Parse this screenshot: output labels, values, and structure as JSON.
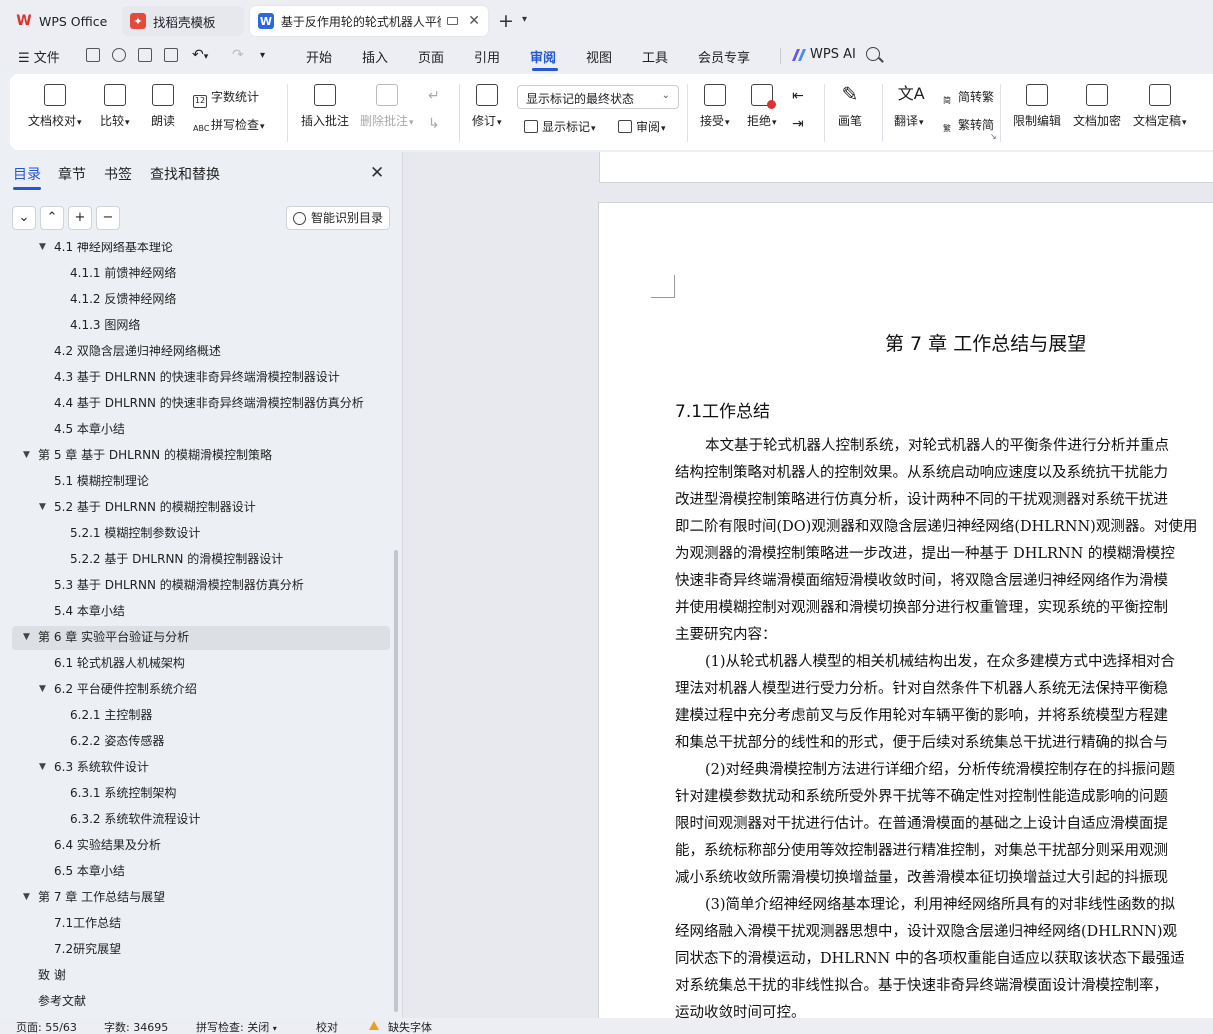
{
  "tabs": [
    {
      "label": "WPS Office"
    },
    {
      "label": "找稻壳模板"
    },
    {
      "label": "基于反作用轮的轮式机器人平衡"
    }
  ],
  "menubar": {
    "file": "文件",
    "items": [
      "开始",
      "插入",
      "页面",
      "引用",
      "审阅",
      "视图",
      "工具",
      "会员专享"
    ],
    "ai": "WPS AI",
    "active": "审阅"
  },
  "ribbon": {
    "doc_check": "文档校对",
    "compare": "比较",
    "read_aloud": "朗读",
    "word_count": "字数统计",
    "spell_check": "拼写检查",
    "insert_comment": "插入批注",
    "delete_comment": "删除批注",
    "track_changes": "修订",
    "markup_mode": "显示标记的最终状态",
    "show_markup": "显示标记",
    "review_pane": "审阅",
    "accept": "接受",
    "reject": "拒绝",
    "pen": "画笔",
    "translate": "翻译",
    "to_traditional": "简转繁",
    "to_simplified": "繁转简",
    "restrict_edit": "限制编辑",
    "encrypt": "文档加密",
    "finalize": "文档定稿"
  },
  "navpane": {
    "tabs": [
      "目录",
      "章节",
      "书签",
      "查找和替换"
    ],
    "smart_toc": "智能识别目录",
    "toc": [
      {
        "text": "4.1 神经网络基本理论",
        "level": 2,
        "expanded": true
      },
      {
        "text": "4.1.1  前馈神经网络",
        "level": 3
      },
      {
        "text": "4.1.2  反馈神经网络",
        "level": 3
      },
      {
        "text": "4.1.3  图网络",
        "level": 3
      },
      {
        "text": "4.2  双隐含层递归神经网络概述",
        "level": 2
      },
      {
        "text": "4.3  基于 DHLRNN 的快速非奇异终端滑模控制器设计",
        "level": 2
      },
      {
        "text": "4.4  基于 DHLRNN 的快速非奇异终端滑模控制器仿真分析",
        "level": 2
      },
      {
        "text": "4.5  本章小结",
        "level": 2
      },
      {
        "text": "第 5 章  基于 DHLRNN 的模糊滑模控制策略",
        "level": 1,
        "expanded": true
      },
      {
        "text": "5.1  模糊控制理论",
        "level": 2
      },
      {
        "text": "5.2  基于 DHLRNN 的模糊控制器设计",
        "level": 2,
        "expanded": true
      },
      {
        "text": "5.2.1  模糊控制参数设计",
        "level": 3
      },
      {
        "text": "5.2.2  基于 DHLRNN 的滑模控制器设计",
        "level": 3
      },
      {
        "text": "5.3  基于 DHLRNN 的模糊滑模控制器仿真分析",
        "level": 2
      },
      {
        "text": "5.4  本章小结",
        "level": 2
      },
      {
        "text": "第 6 章  实验平台验证与分析",
        "level": 1,
        "expanded": true,
        "selected": true
      },
      {
        "text": "6.1  轮式机器人机械架构",
        "level": 2
      },
      {
        "text": "6.2  平台硬件控制系统介绍",
        "level": 2,
        "expanded": true
      },
      {
        "text": "6.2.1  主控制器",
        "level": 3
      },
      {
        "text": "6.2.2  姿态传感器",
        "level": 3
      },
      {
        "text": "6.3  系统软件设计",
        "level": 2,
        "expanded": true
      },
      {
        "text": "6.3.1  系统控制架构",
        "level": 3
      },
      {
        "text": "6.3.2  系统软件流程设计",
        "level": 3
      },
      {
        "text": "6.4  实验结果及分析",
        "level": 2
      },
      {
        "text": "6.5  本章小结",
        "level": 2
      },
      {
        "text": "第 7 章  工作总结与展望",
        "level": 1,
        "expanded": true
      },
      {
        "text": "7.1工作总结",
        "level": 2
      },
      {
        "text": "7.2研究展望",
        "level": 2
      },
      {
        "text": "致  谢",
        "level": 1
      },
      {
        "text": "参考文献",
        "level": 1
      }
    ]
  },
  "document": {
    "chapter_title": "第 7 章  工作总结与展望",
    "section_title": "7.1工作总结",
    "lines": [
      {
        "text": "本文基于轮式机器人控制系统，对轮式机器人的平衡条件进行分析并重点",
        "indent": true
      },
      {
        "text": "结构控制策略对机器人的控制效果。从系统启动响应速度以及系统抗干扰能力",
        "indent": false
      },
      {
        "text": "改进型滑模控制策略进行仿真分析，设计两种不同的干扰观测器对系统干扰进",
        "indent": false
      },
      {
        "text": "即二阶有限时间(DO)观测器和双隐含层递归神经网络(DHLRNN)观测器。对使用",
        "indent": false
      },
      {
        "text": "为观测器的滑模控制策略进一步改进，提出一种基于 DHLRNN 的模糊滑模控",
        "indent": false
      },
      {
        "text": "快速非奇异终端滑模面缩短滑模收敛时间，将双隐含层递归神经网络作为滑模",
        "indent": false
      },
      {
        "text": "并使用模糊控制对观测器和滑模切换部分进行权重管理，实现系统的平衡控制",
        "indent": false
      },
      {
        "text": "主要研究内容：",
        "indent": false
      },
      {
        "text": "(1)从轮式机器人模型的相关机械结构出发，在众多建模方式中选择相对合",
        "indent": true
      },
      {
        "text": "理法对机器人模型进行受力分析。针对自然条件下机器人系统无法保持平衡稳",
        "indent": false
      },
      {
        "text": "建模过程中充分考虑前叉与反作用轮对车辆平衡的影响，并将系统模型方程建",
        "indent": false
      },
      {
        "text": "和集总干扰部分的线性和的形式，便于后续对系统集总干扰进行精确的拟合与",
        "indent": false
      },
      {
        "text": "(2)对经典滑模控制方法进行详细介绍，分析传统滑模控制存在的抖振问题",
        "indent": true
      },
      {
        "text": "针对建模参数扰动和系统所受外界干扰等不确定性对控制性能造成影响的问题",
        "indent": false
      },
      {
        "text": "限时间观测器对干扰进行估计。在普通滑模面的基础之上设计自适应滑模面提",
        "indent": false
      },
      {
        "text": "能，系统标称部分使用等效控制器进行精准控制，对集总干扰部分则采用观测",
        "indent": false
      },
      {
        "text": "减小系统收敛所需滑模切换增益量，改善滑模本征切换增益过大引起的抖振现",
        "indent": false
      },
      {
        "text": "(3)简单介绍神经网络基本理论，利用神经网络所具有的对非线性函数的拟",
        "indent": true
      },
      {
        "text": "经网络融入滑模干扰观测器思想中，设计双隐含层递归神经网络(DHLRNN)观",
        "indent": false
      },
      {
        "text": "同状态下的滑模运动，DHLRNN 中的各项权重能自适应以获取该状态下最强适",
        "indent": false
      },
      {
        "text": "对系统集总干扰的非线性拟合。基于快速非奇异终端滑模面设计滑模控制率，",
        "indent": false
      },
      {
        "text": "运动收敛时间可控。",
        "indent": false
      }
    ]
  },
  "statusbar": {
    "page": "页面: 55/63",
    "words": "字数: 34695",
    "spell": "拼写检查: 关闭",
    "proof": "校对",
    "missing_font": "缺失字体"
  }
}
